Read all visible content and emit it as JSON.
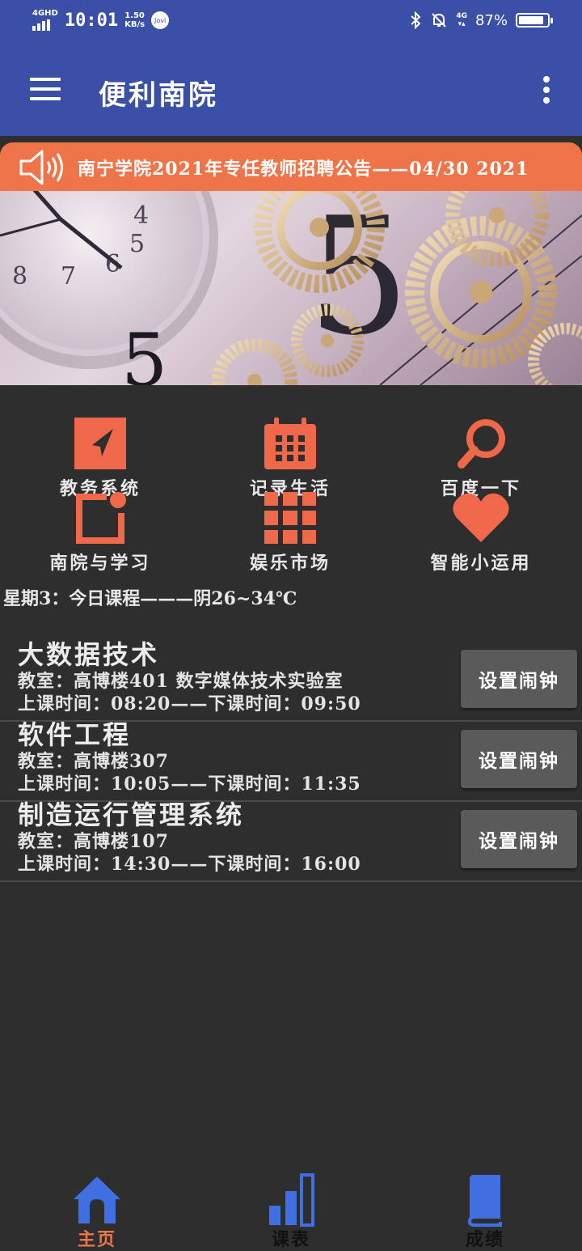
{
  "status_bar": {
    "signal": "4GHD",
    "time": "10:01",
    "speed_value": "1.50",
    "speed_unit": "KB/s",
    "assistant": "Jovi",
    "network": "4G",
    "battery": "87%",
    "battery_level": 0.87
  },
  "app_bar": {
    "title": "便利南院"
  },
  "ticker": {
    "text": "南宁学院2021年专任教师招聘公告——04/30 2021",
    "icon": "speaker-icon"
  },
  "grid": {
    "items": [
      {
        "label": "教务系统",
        "icon": "navigation-arrow-icon"
      },
      {
        "label": "记录生活",
        "icon": "calendar-icon"
      },
      {
        "label": "百度一下",
        "icon": "magnifier-icon"
      },
      {
        "label": "南院与学习",
        "icon": "notification-square-icon"
      },
      {
        "label": "娱乐市场",
        "icon": "apps-grid-icon"
      },
      {
        "label": "智能小运用",
        "icon": "heart-icon"
      }
    ],
    "accent_color": "#f0684a"
  },
  "today": {
    "text": "星期3：今日课程———阴26~34℃"
  },
  "courses": [
    {
      "name": "大数据技术",
      "room": "教室：高博楼401 数字媒体技术实验室",
      "time": "上课时间：08:20——下课时间：09:50",
      "button": "设置闹钟"
    },
    {
      "name": "软件工程",
      "room": "教室：高博楼307",
      "time": "上课时间：10:05——下课时间：11:35",
      "button": "设置闹钟"
    },
    {
      "name": "制造运行管理系统",
      "room": "教室：高博楼107",
      "time": "上课时间：14:30——下课时间：16:00",
      "button": "设置闹钟"
    }
  ],
  "bottom_nav": {
    "items": [
      {
        "label": "主页",
        "icon": "home-icon",
        "active": true
      },
      {
        "label": "课表",
        "icon": "bar-chart-icon",
        "active": false
      },
      {
        "label": "成绩",
        "icon": "book-icon",
        "active": false
      }
    ],
    "active_color": "#f0744a",
    "icon_color": "#3f6fe0"
  }
}
